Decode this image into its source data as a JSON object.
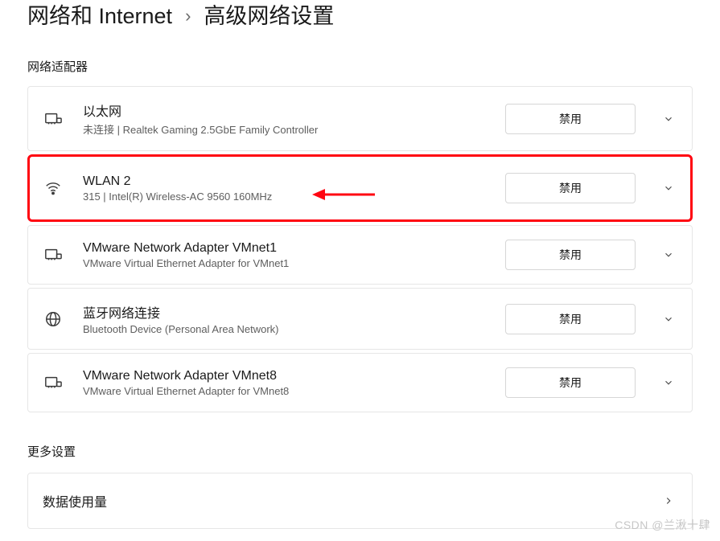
{
  "breadcrumb": {
    "parent": "网络和 Internet",
    "separator": "›",
    "current": "高级网络设置"
  },
  "sections": {
    "adapters_title": "网络适配器",
    "more_title": "更多设置",
    "data_usage_label": "数据使用量"
  },
  "adapters": [
    {
      "icon": "ethernet",
      "title": "以太网",
      "subtitle": "未连接 | Realtek Gaming 2.5GbE Family Controller",
      "button": "禁用",
      "highlighted": false
    },
    {
      "icon": "wifi",
      "title": "WLAN 2",
      "subtitle": "315 | Intel(R) Wireless-AC 9560 160MHz",
      "button": "禁用",
      "highlighted": true
    },
    {
      "icon": "ethernet",
      "title": "VMware Network Adapter VMnet1",
      "subtitle": "VMware Virtual Ethernet Adapter for VMnet1",
      "button": "禁用",
      "highlighted": false
    },
    {
      "icon": "bluetooth-globe",
      "title": "蓝牙网络连接",
      "subtitle": "Bluetooth Device (Personal Area Network)",
      "button": "禁用",
      "highlighted": false
    },
    {
      "icon": "ethernet",
      "title": "VMware Network Adapter VMnet8",
      "subtitle": "VMware Virtual Ethernet Adapter for VMnet8",
      "button": "禁用",
      "highlighted": false
    }
  ],
  "watermark": "CSDN @兰湫十肆",
  "colors": {
    "highlight_border": "#ff0511",
    "arrow": "#ff0511"
  }
}
